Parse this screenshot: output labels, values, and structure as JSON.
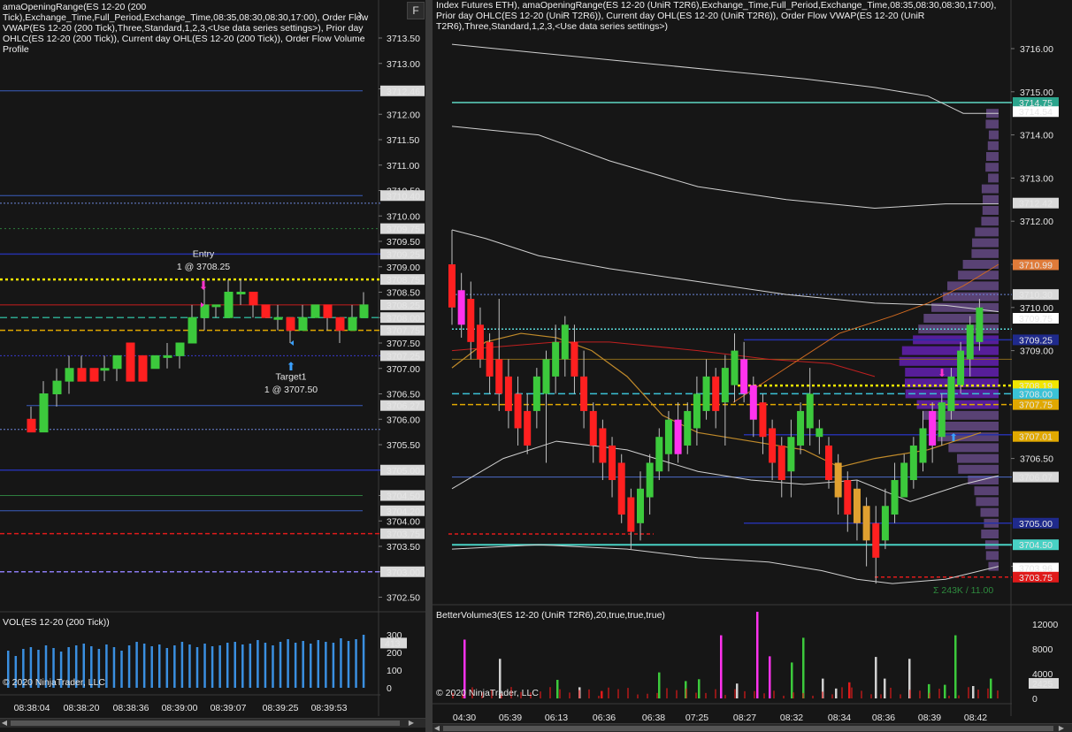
{
  "left": {
    "caption": "amaOpeningRange(ES 12-20 (200 Tick),Exchange_Time,Full_Period,Exchange_Time,08:35,08:30,08:30,17:00), Order Flow VWAP(ES 12-20 (200 Tick),Three,Standard,1,2,3,<Use data series settings>), Prior day OHLC(ES 12-20 (200 Tick)), Current day OHL(ES 12-20 (200 Tick)), Order Flow Volume Profile",
    "f_button": "F",
    "nav_icon": "chevron-right-icon",
    "price_ticks": [
      "3713.50",
      "3713.00",
      "3712.50",
      "3712.00",
      "3711.50",
      "3711.00",
      "3710.50",
      "3710.00",
      "3709.50",
      "3709.00",
      "3708.50",
      "3708.00",
      "3707.50",
      "3707.00",
      "3706.50",
      "3706.00",
      "3705.50",
      "3705.00",
      "3704.50",
      "3704.00",
      "3703.50",
      "3703.00",
      "3702.50"
    ],
    "price_badges": [
      {
        "label": "3712.46",
        "bg": "#d9d9d9",
        "fg": "#000000"
      },
      {
        "label": "3710.40",
        "bg": "#d9d9d9",
        "fg": "#000000"
      },
      {
        "label": "3709.75",
        "bg": "#d9d9d9",
        "fg": "#000000"
      },
      {
        "label": "3709.25",
        "bg": "#d9d9d9",
        "fg": "#000000"
      },
      {
        "label": "3708.75",
        "bg": "#d9d9d9",
        "fg": "#000000"
      },
      {
        "label": "3708.25",
        "bg": "#d9d9d9",
        "fg": "#000000"
      },
      {
        "label": "3708.00",
        "bg": "#d9d9d9",
        "fg": "#000000"
      },
      {
        "label": "3707.75",
        "bg": "#d9d9d9",
        "fg": "#000000"
      },
      {
        "label": "3707.25",
        "bg": "#d9d9d9",
        "fg": "#000000"
      },
      {
        "label": "3706.27",
        "bg": "#d9d9d9",
        "fg": "#000000"
      },
      {
        "label": "3705.00",
        "bg": "#d9d9d9",
        "fg": "#000000"
      },
      {
        "label": "3704.50",
        "bg": "#d9d9d9",
        "fg": "#000000"
      },
      {
        "label": "3704.20",
        "bg": "#d9d9d9",
        "fg": "#000000"
      },
      {
        "label": "3703.75",
        "bg": "#d9d9d9",
        "fg": "#000000"
      },
      {
        "label": "3703.00",
        "bg": "#d9d9d9",
        "fg": "#000000"
      }
    ],
    "entry_label": "Entry",
    "entry_detail": "1 @ 3708.25",
    "target_label": "Target1",
    "target_detail": "1 @ 3707.50",
    "volume_title": "VOL(ES 12-20 (200 Tick))",
    "volume_ticks": [
      "300",
      "200",
      "100",
      "0"
    ],
    "volume_badge": "413",
    "copyright": "© 2020 NinjaTrader, LLC",
    "time_ticks": [
      "08:38:04",
      "08:38:20",
      "08:38:36",
      "08:39:00",
      "08:39:07",
      "08:39:25",
      "08:39:53"
    ],
    "volume_bars": [
      210,
      180,
      220,
      230,
      215,
      240,
      225,
      205,
      230,
      240,
      250,
      235,
      220,
      245,
      230,
      210,
      240,
      260,
      250,
      235,
      245,
      225,
      240,
      260,
      245,
      230,
      250,
      235,
      240,
      255,
      260,
      245,
      250,
      270,
      255,
      240,
      260,
      275,
      255,
      265,
      250,
      270,
      260,
      255,
      280,
      265,
      275,
      413
    ]
  },
  "right": {
    "caption": "Index Futures ETH), amaOpeningRange(ES 12-20 (UniR T2R6),Exchange_Time,Full_Period,Exchange_Time,08:35,08:30,08:30,17:00), Prior day OHLC(ES 12-20 (UniR T2R6)), Current day OHL(ES 12-20 (UniR T2R6)), Order Flow VWAP(ES 12-20 (UniR T2R6),Three,Standard,1,2,3,<Use data series settings>)",
    "price_ticks": [
      "3716.00",
      "3715.00",
      "3714.00",
      "3713.00",
      "3712.00",
      "3711.00",
      "3710.00",
      "3709.00",
      "3706.50",
      "3704.00"
    ],
    "price_badges": [
      {
        "label": "3714.75",
        "bg": "#2ca58d",
        "fg": "#ffffff"
      },
      {
        "label": "3714.54",
        "bg": "#ffffff",
        "fg": "#000000"
      },
      {
        "label": "3712.42",
        "bg": "#d9d9d9",
        "fg": "#000000"
      },
      {
        "label": "3710.99",
        "bg": "#e07b39",
        "fg": "#000000"
      },
      {
        "label": "3710.30",
        "bg": "#d9d9d9",
        "fg": "#000000"
      },
      {
        "label": "3709.75",
        "bg": "#ffffff",
        "fg": "#000000"
      },
      {
        "label": "3709.25",
        "bg": "#1f2a8c",
        "fg": "#ffffff"
      },
      {
        "label": "3708.19",
        "bg": "#f2e600",
        "fg": "#000000"
      },
      {
        "label": "3708.00",
        "bg": "#3ac2d6",
        "fg": "#000000"
      },
      {
        "label": "3707.75",
        "bg": "#e0a800",
        "fg": "#000000"
      },
      {
        "label": "3707.01",
        "bg": "#e0a800",
        "fg": "#000000"
      },
      {
        "label": "3706.07",
        "bg": "#d9d9d9",
        "fg": "#000000"
      },
      {
        "label": "3705.00",
        "bg": "#1f2a8c",
        "fg": "#ffffff"
      },
      {
        "label": "3704.50",
        "bg": "#48d1c4",
        "fg": "#000000"
      },
      {
        "label": "3703.96",
        "bg": "#ffffff",
        "fg": "#000000"
      },
      {
        "label": "3703.75",
        "bg": "#e01a1a",
        "fg": "#ffffff"
      }
    ],
    "profile_label": "Σ 243K / 11.00",
    "volume_title": "BetterVolume3(ES 12-20 (UniR T2R6),20,true,true,true)",
    "volume_ticks": [
      "12000",
      "8000",
      "4000",
      "0"
    ],
    "volume_badge": "2425",
    "copyright": "© 2020 NinjaTrader, LLC",
    "time_ticks": [
      "04:30",
      "05:39",
      "06:13",
      "06:36",
      "06:38",
      "07:25",
      "08:27",
      "08:32",
      "08:34",
      "08:36",
      "08:39",
      "08:42"
    ]
  }
}
